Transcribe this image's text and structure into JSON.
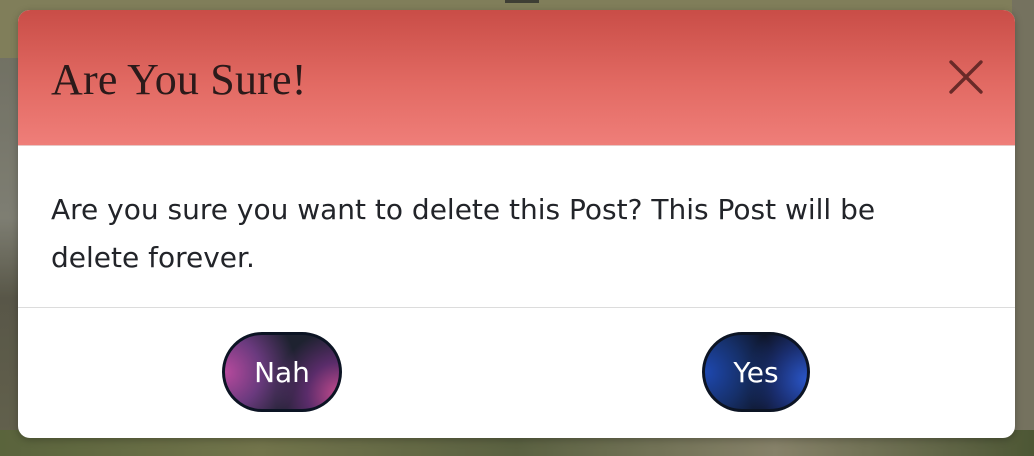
{
  "modal": {
    "title": "Are You Sure!",
    "message": "Are you sure you want to delete this Post? This Post will be delete forever.",
    "close_icon": "close-icon",
    "buttons": {
      "cancel_label": "Nah",
      "confirm_label": "Yes"
    },
    "colors": {
      "header_top": "#c94d47",
      "header_bottom": "#ef7e79",
      "cancel_accent": "#b74a9d",
      "confirm_accent": "#1e48b0"
    }
  }
}
